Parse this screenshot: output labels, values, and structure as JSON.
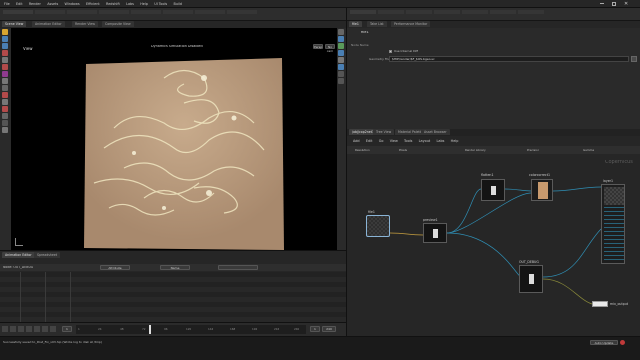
{
  "app": {
    "title": "houdini",
    "menus": [
      "File",
      "Edit",
      "Render",
      "Assets",
      "Windows",
      "Efficient",
      "Redshift",
      "Labs",
      "Help",
      "UI Tools",
      "Build"
    ],
    "right_menus": [
      "File",
      "Edit",
      "Render",
      "Assets",
      "Windows",
      "Efficient",
      "Redshift",
      "Labs",
      "Help",
      "UI Tools",
      "Build"
    ]
  },
  "viewport": {
    "tabs": [
      "Scene View",
      "Animation Editor",
      "Render View",
      "Composite View"
    ],
    "view_label": "View",
    "title": "Dynamics Simulation Disabled",
    "camera_btn": "Persp",
    "cam_btn2": "No cam"
  },
  "params": {
    "tabs": [
      "file1",
      "Take List",
      "Performance Monitor"
    ],
    "node_name": "file1",
    "path_label": "Node Name",
    "checkbox_label": "Use Internal Diff",
    "file_label": "Geometry File",
    "file_value": "$HIP/render/$F_$OS.bgeo.sc"
  },
  "network": {
    "tabs": [
      "/obj/cop2net1",
      "Tree View",
      "Material Palette",
      "Asset Browser"
    ],
    "menus": [
      "Add",
      "Edit",
      "Go",
      "View",
      "Tools",
      "Layout",
      "Labs",
      "Help"
    ],
    "fields": [
      "Resolution",
      "Pixels",
      "Render Library",
      "Precision",
      "Gamma"
    ],
    "context_label": "Copernicus",
    "nodes": [
      {
        "label": "file1"
      },
      {
        "label": "preview1"
      },
      {
        "label": "flatten1"
      },
      {
        "label": "colorcorrect1"
      },
      {
        "label": "layer1"
      },
      {
        "label": "mix_output"
      },
      {
        "label": "OUT_DEBUG"
      }
    ]
  },
  "timeline": {
    "tabs": [
      "Animation Editor",
      "Spreadsheet"
    ],
    "header_fields": [
      "Node: OUT_DEBUG",
      "Attribute",
      "Name"
    ],
    "frame_current": "1",
    "frame_start": "1",
    "frame_end": "240",
    "ticks": [
      "1",
      "24",
      "48",
      "72",
      "96",
      "120",
      "144",
      "168",
      "192",
      "216",
      "240"
    ]
  },
  "statusbar": {
    "text": "Successfully saved to_Post_Fix_v03.hip (Wrote log to disk at /tmp)",
    "right_btn": "Auto Update"
  },
  "colors": {
    "accent": "#c87a3a",
    "sim_bg": "#b5977a",
    "wire": "#2f8fb5",
    "wire2": "#8a8a3a"
  }
}
